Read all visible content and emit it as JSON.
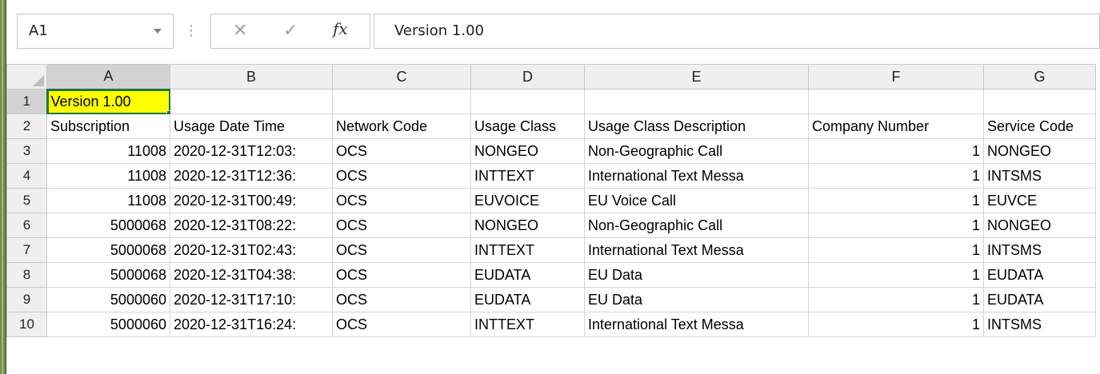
{
  "formula_bar": {
    "name_box": "A1",
    "cancel_symbol": "✕",
    "enter_symbol": "✓",
    "fx_symbol": "fx",
    "content": "Version 1.00"
  },
  "columns": [
    "A",
    "B",
    "C",
    "D",
    "E",
    "F",
    "G"
  ],
  "rows": [
    {
      "num": "1",
      "cells": [
        "Version 1.00",
        "",
        "",
        "",
        "",
        "",
        ""
      ]
    },
    {
      "num": "2",
      "cells": [
        "Subscription",
        "Usage Date Time",
        "Network Code",
        "Usage Class",
        "Usage Class Description",
        "Company Number",
        "Service Code"
      ]
    },
    {
      "num": "3",
      "cells": [
        "11008",
        "2020-12-31T12:03:",
        "OCS",
        "NONGEO",
        "Non-Geographic Call",
        "1",
        "NONGEO"
      ]
    },
    {
      "num": "4",
      "cells": [
        "11008",
        "2020-12-31T12:36:",
        "OCS",
        "INTTEXT",
        "International Text Messa",
        "1",
        "INTSMS"
      ]
    },
    {
      "num": "5",
      "cells": [
        "11008",
        "2020-12-31T00:49:",
        "OCS",
        "EUVOICE",
        "EU Voice Call",
        "1",
        "EUVCE"
      ]
    },
    {
      "num": "6",
      "cells": [
        "5000068",
        "2020-12-31T08:22:",
        "OCS",
        "NONGEO",
        "Non-Geographic Call",
        "1",
        "NONGEO"
      ]
    },
    {
      "num": "7",
      "cells": [
        "5000068",
        "2020-12-31T02:43:",
        "OCS",
        "INTTEXT",
        "International Text Messa",
        "1",
        "INTSMS"
      ]
    },
    {
      "num": "8",
      "cells": [
        "5000068",
        "2020-12-31T04:38:",
        "OCS",
        "EUDATA",
        "EU Data",
        "1",
        "EUDATA"
      ]
    },
    {
      "num": "9",
      "cells": [
        "5000060",
        "2020-12-31T17:10:",
        "OCS",
        "EUDATA",
        "EU Data",
        "1",
        "EUDATA"
      ]
    },
    {
      "num": "10",
      "cells": [
        "5000060",
        "2020-12-31T16:24:",
        "OCS",
        "INTTEXT",
        "International Text Messa",
        "1",
        "INTSMS"
      ]
    }
  ],
  "colors": {
    "selection": "#217346",
    "highlight": "#ffff00"
  }
}
